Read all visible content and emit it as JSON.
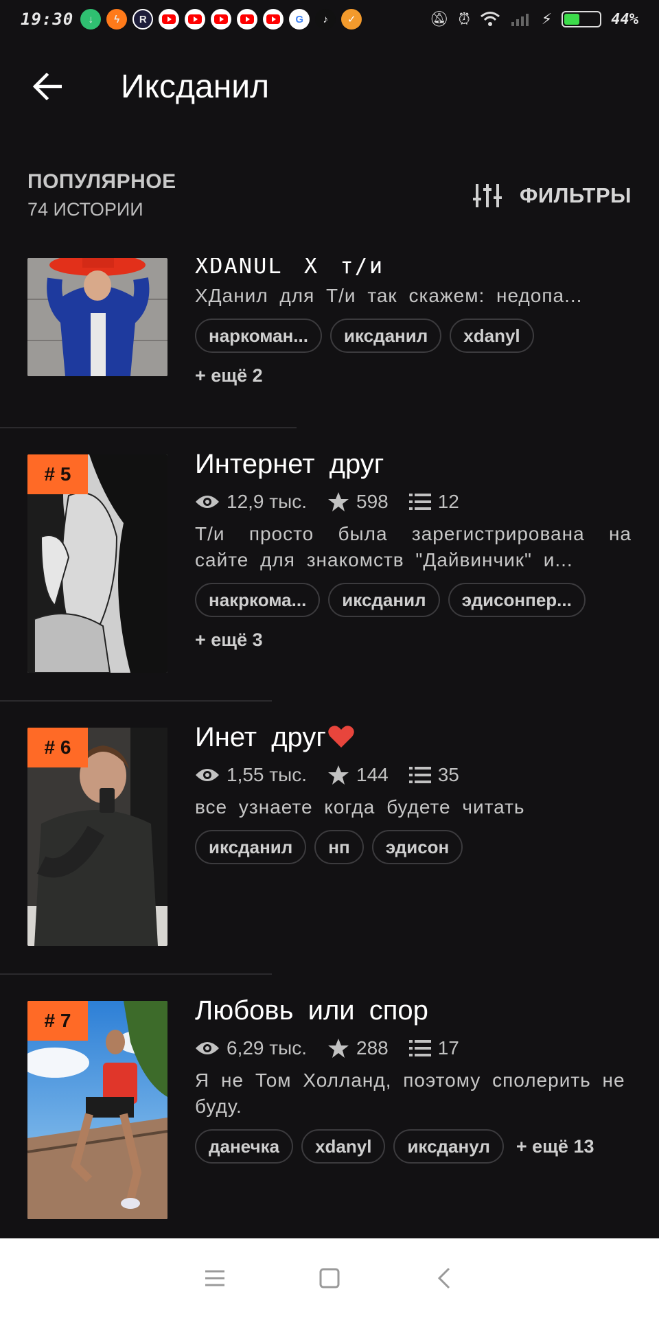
{
  "status_bar": {
    "time": "19:30",
    "battery_percent_label": "44%",
    "battery_level": 0.44,
    "app_icons": [
      "download-app-icon",
      "messenger-icon",
      "r-app-icon",
      "youtube-icon",
      "youtube-icon",
      "youtube-icon",
      "youtube-icon",
      "youtube-icon",
      "google-icon",
      "tiktok-icon",
      "vpn-app-icon"
    ]
  },
  "appbar": {
    "title": "Иксданил"
  },
  "section": {
    "title": "ПОПУЛЯРНОЕ",
    "subtitle": "74 ИСТОРИИ",
    "filters_label": "ФИЛЬТРЫ"
  },
  "stories": [
    {
      "rank": "",
      "title": "XDANUL X т/и",
      "views": "",
      "stars": "",
      "parts": "",
      "description": "ХДанил для Т/и так скажем: недопа...",
      "tags": [
        "наркоман...",
        "иксданил",
        "xdanyl"
      ],
      "more": "+ ещё 2"
    },
    {
      "rank": "# 5",
      "title": "Интернет друг",
      "views": "12,9 тыс.",
      "stars": "598",
      "parts": "12",
      "description": "Т/и просто была зарегистрирована на сайте для знакомств \"Дайвинчик\" и...",
      "tags": [
        "накркома...",
        "иксданил",
        "эдисонпер..."
      ],
      "more": "+ ещё 3"
    },
    {
      "rank": "# 6",
      "title": "Инет друг",
      "views": "1,55 тыс.",
      "stars": "144",
      "parts": "35",
      "description": "все узнаете когда будете читать",
      "tags": [
        "иксданил",
        "нп",
        "эдисон"
      ],
      "more": ""
    },
    {
      "rank": "# 7",
      "title": "Любовь или спор",
      "views": "6,29 тыс.",
      "stars": "288",
      "parts": "17",
      "description": "Я не Том Холланд, поэтому сполерить не буду.",
      "tags": [
        "данечка",
        "xdanyl",
        "иксданул"
      ],
      "more": "+ ещё 13"
    }
  ],
  "colors": {
    "background": "#121113",
    "rank_badge": "#ff6a26",
    "heart": "#e8453c",
    "navbar": "#ffffff"
  },
  "navbar": {
    "icons": [
      "menu-icon",
      "home-icon",
      "back-triangle-icon"
    ]
  }
}
